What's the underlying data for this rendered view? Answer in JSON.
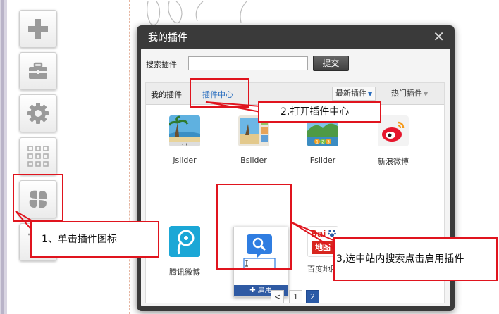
{
  "dialog": {
    "title": "我的插件",
    "close_glyph": "✕",
    "search_label": "搜索插件",
    "search_value": "",
    "submit_label": "提交"
  },
  "tabs": {
    "my_plugins": "我的插件",
    "plugin_center": "插件中心",
    "newest": "最新插件",
    "popular": "热门插件",
    "sort_arrow": "▼"
  },
  "plugins": [
    {
      "name": "Jslider"
    },
    {
      "name": "Bslider"
    },
    {
      "name": "Fslider"
    },
    {
      "name": "新浪微博"
    },
    {
      "name": "腾讯微博"
    },
    {
      "name": "站内搜索",
      "enable_label": "启用"
    },
    {
      "name": "百度地图",
      "logo_text": "Bai",
      "logo_sub": "地图"
    }
  ],
  "fslider_badges": [
    "1",
    "2",
    "3"
  ],
  "pager": {
    "prev": "<",
    "pages": [
      "1",
      "2"
    ],
    "current": "2"
  },
  "annotations": {
    "step1": "1、单击插件图标",
    "step2": "2,打开插件中心",
    "step3": "3,选中站内搜索点击启用插件"
  },
  "colors": {
    "annotation_red": "#e0141e",
    "dialog_header": "#3a3a3a",
    "accent_blue": "#2a5aa6"
  },
  "icons": [
    "plus-icon",
    "toolbox-icon",
    "gear-icon",
    "grid-icon",
    "plugin-clover-icon",
    "cart-icon"
  ]
}
